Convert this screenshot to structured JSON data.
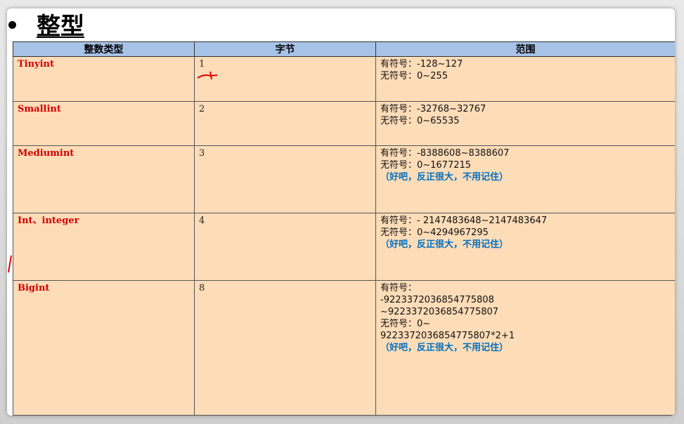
{
  "slide": {
    "title": "整型"
  },
  "table": {
    "headers": [
      "整数类型",
      "字节",
      "范围"
    ],
    "rows": [
      {
        "type": "Tinyint",
        "bytes": "1",
        "range": [
          "有符号：-128~127",
          "无符号：0~255"
        ],
        "note": ""
      },
      {
        "type": "Smallint",
        "bytes": "2",
        "range": [
          "有符号：-32768~32767",
          "无符号：0~65535"
        ],
        "note": ""
      },
      {
        "type": "Mediumint",
        "bytes": "3",
        "range": [
          "有符号：-8388608~8388607",
          "无符号：0~1677215"
        ],
        "note": "（好吧，反正很大，不用记住）"
      },
      {
        "type": "Int、integer",
        "bytes": "4",
        "range": [
          "有符号：- 2147483648~2147483647",
          "无符号：0~4294967295"
        ],
        "note": "（好吧，反正很大，不用记住）"
      },
      {
        "type": "Bigint",
        "bytes": "8",
        "range": [
          "有符号：",
          "-9223372036854775808",
          "~9223372036854775807",
          "无符号：0~",
          "9223372036854775807*2+1"
        ],
        "note": "（好吧，反正很大，不用记住）"
      }
    ]
  },
  "colors": {
    "header_bg": "#a8c3e8",
    "cell_bg": "#fddcb8",
    "type_text": "#d10000",
    "note_text": "#0070c0"
  }
}
